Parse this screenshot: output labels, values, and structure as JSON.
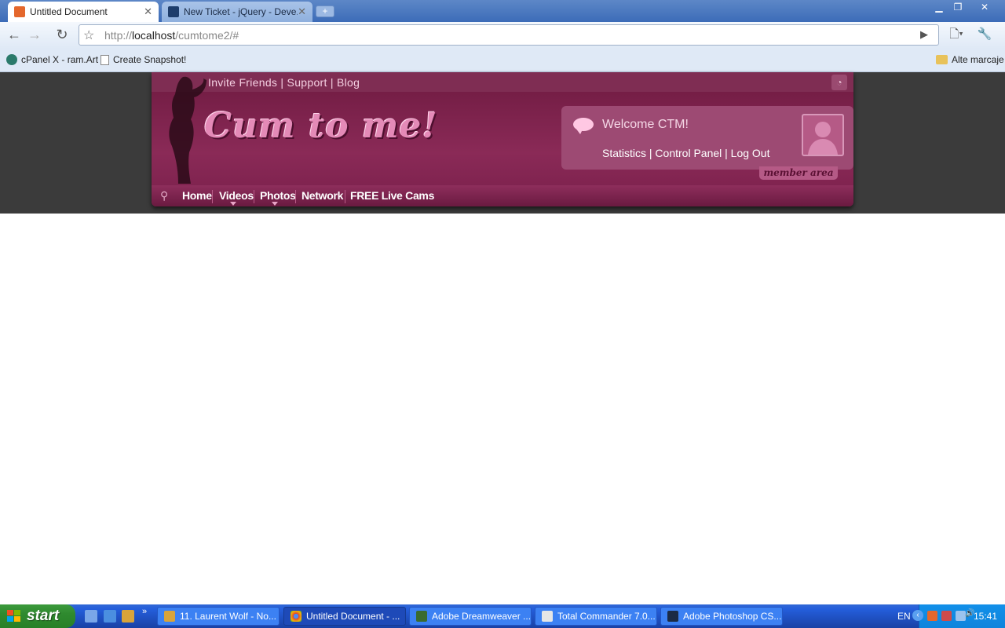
{
  "browser": {
    "tabs": [
      {
        "title": "Untitled Document",
        "icon": "xampp-icon",
        "active": true
      },
      {
        "title": "New Ticket - jQuery - Deve...",
        "icon": "trac-icon",
        "active": false
      }
    ],
    "url": {
      "scheme": "http://",
      "host": "localhost",
      "path": "/cumtome2/#"
    },
    "bookmarks": [
      {
        "label": "cPanel X - ram.Art",
        "icon": "cpanel-icon"
      },
      {
        "label": "Create Snapshot!",
        "icon": "page-icon"
      }
    ],
    "other_bookmarks": "Alte marcaje"
  },
  "site": {
    "top_links": "Invite Friends | Support | Blog",
    "logo_text": "Cum to me!",
    "welcome": "Welcome CTM!",
    "member_links": "Statistics | Control Panel | Log Out",
    "member_area_tab": "member area",
    "nav": [
      "Home",
      "Videos",
      "Photos",
      "Network",
      "FREE Live Cams"
    ]
  },
  "taskbar": {
    "start": "start",
    "tasks": [
      {
        "label": "11. Laurent Wolf - No...",
        "icon": "winamp-icon",
        "active": false
      },
      {
        "label": "Untitled Document - ...",
        "icon": "chrome-icon",
        "active": true
      },
      {
        "label": "Adobe Dreamweaver ...",
        "icon": "dreamweaver-icon",
        "active": false
      },
      {
        "label": "Total Commander 7.0...",
        "icon": "total-commander-icon",
        "active": false
      },
      {
        "label": "Adobe Photoshop CS...",
        "icon": "photoshop-icon",
        "active": false
      }
    ],
    "language": "EN",
    "clock": "15:41"
  },
  "colors": {
    "site_primary": "#8a2a57",
    "site_dark": "#6e1a40",
    "accent_pink": "#e48ab7",
    "taskbar_blue": "#245edb"
  }
}
